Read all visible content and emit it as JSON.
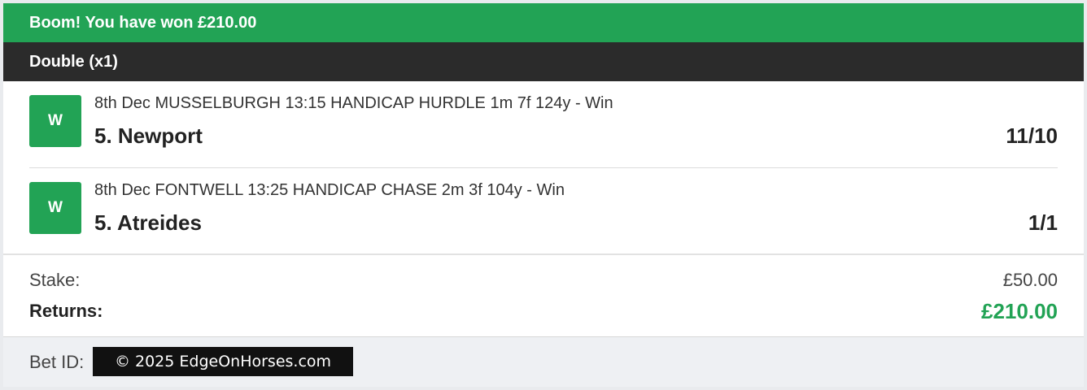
{
  "banner": {
    "text": "Boom! You have won £210.00"
  },
  "bet": {
    "type_label": "Double (x1)"
  },
  "selections": [
    {
      "result": "W",
      "event": "8th Dec MUSSELBURGH 13:15 HANDICAP HURDLE 1m 7f 124y - Win",
      "runner": "5. Newport",
      "odds": "11/10"
    },
    {
      "result": "W",
      "event": "8th Dec FONTWELL 13:25 HANDICAP CHASE 2m 3f 104y - Win",
      "runner": "5. Atreides",
      "odds": "1/1"
    }
  ],
  "summary": {
    "stake_label": "Stake:",
    "stake_value": "£50.00",
    "returns_label": "Returns:",
    "returns_value": "£210.00"
  },
  "footer": {
    "bet_id_label": "Bet ID:",
    "copyright": "© 2025 EdgeOnHorses.com"
  },
  "colors": {
    "win_green": "#22a355",
    "header_dark": "#2b2b2b",
    "footer_bg": "#eef0f3"
  }
}
